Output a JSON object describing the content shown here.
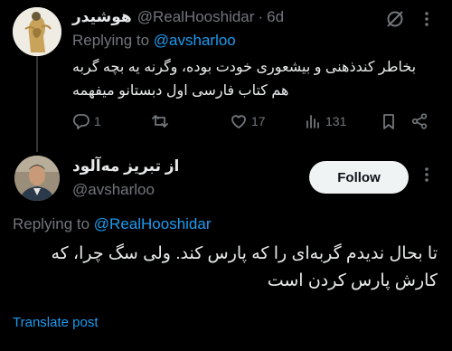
{
  "reply_tweet": {
    "display_name": "هوشیدر",
    "handle": "@RealHooshidar",
    "separator": "·",
    "time": "6d",
    "replying_prefix": "Replying to",
    "replying_handle": "@avsharloo",
    "text_line1": "بخاطر کندذهنی و بیشعوری خودت بوده، وگرنه یه بچه گربه",
    "text_line2": "هم کتاب فارسی اول دبستانو میفهمه",
    "counts": {
      "replies": "1",
      "retweets": "",
      "likes": "17",
      "views": "131"
    }
  },
  "main_tweet": {
    "display_name": "از تبریز مه‌آلود",
    "handle": "@avsharloo",
    "follow_label": "Follow",
    "replying_prefix": "Replying to",
    "replying_handle": "@RealHooshidar",
    "text_line1": "تا بحال ندیدم گربه‌ای را که پارس کند. ولی سگ چرا، که",
    "text_line2": "کارش پارس کردن است",
    "translate_label": "Translate post"
  },
  "colors": {
    "background": "#000000",
    "text": "#e7e9ea",
    "muted": "#71767b",
    "link": "#1d9bf0",
    "follow_bg": "#eff3f4"
  },
  "icons": [
    "grok-icon",
    "more-icon",
    "reply-icon",
    "retweet-icon",
    "like-icon",
    "views-icon",
    "bookmark-icon",
    "share-icon"
  ]
}
